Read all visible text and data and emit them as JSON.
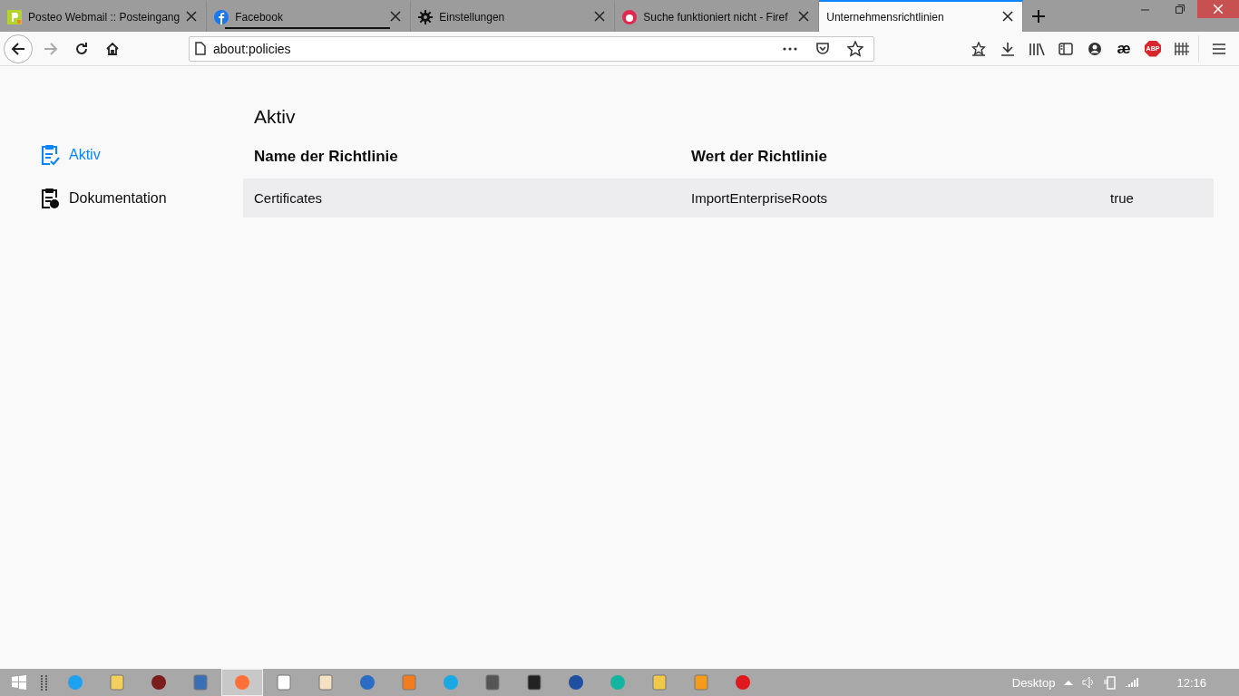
{
  "tabs": [
    {
      "title": "Posteo Webmail :: Posteingang",
      "selected": false,
      "attention": false
    },
    {
      "title": "Facebook",
      "selected": false,
      "attention": true
    },
    {
      "title": "Einstellungen",
      "selected": false,
      "attention": false
    },
    {
      "title": "Suche funktioniert nicht - Firef",
      "selected": false,
      "attention": false
    },
    {
      "title": "Unternehmensrichtlinien",
      "selected": true,
      "attention": false
    }
  ],
  "address_bar": {
    "value": "about:policies"
  },
  "toolbar_extensions": [
    {
      "kind": "glyph",
      "text": "æ"
    },
    {
      "kind": "badge",
      "text": "ABP"
    }
  ],
  "sidebar": {
    "items": [
      {
        "label": "Aktiv",
        "selected": true
      },
      {
        "label": "Dokumentation",
        "selected": false
      }
    ]
  },
  "main": {
    "title": "Aktiv",
    "columns": [
      "Name der Richtlinie",
      "Wert der Richtlinie"
    ],
    "rows": [
      {
        "name": "Certificates",
        "key": "ImportEnterpriseRoots",
        "value": "true"
      }
    ]
  },
  "taskbar": {
    "desktop_label": "Desktop",
    "time": "12:16"
  }
}
